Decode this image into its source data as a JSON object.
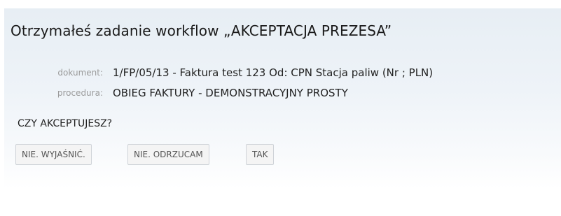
{
  "task": {
    "title": "Otrzymałeś zadanie workflow „AKCEPTACJA PREZESA”",
    "document_label": "dokument:",
    "document_value": "1/FP/05/13 - Faktura test 123 Od: CPN Stacja paliw (Nr ; PLN)",
    "procedure_label": "procedura:",
    "procedure_value": "OBIEG FAKTURY - DEMONSTRACYJNY PROSTY",
    "question": "CZY AKCEPTUJESZ?"
  },
  "actions": {
    "explain_label": "NIE. WYJAŚNIĆ.",
    "reject_label": "NIE. ODRZUCAM",
    "accept_label": "TAK"
  },
  "colors": {
    "panel_top": "#e7eef4",
    "panel_bottom": "#ffffff",
    "button_bg": "#f4f4f4",
    "button_border": "#cfd3d8",
    "label_text": "#9a9a9a"
  }
}
